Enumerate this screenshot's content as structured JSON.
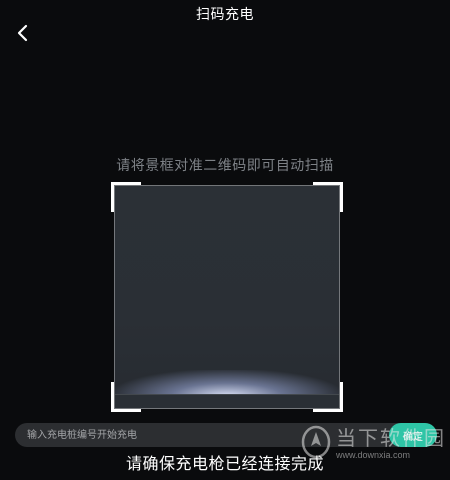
{
  "header": {
    "title": "扫码充电",
    "back_icon": "back-arrow-icon"
  },
  "scanner": {
    "hint": "请将景框对准二维码即可自动扫描",
    "corner_color": "#ffffff",
    "scan_line_icon": "scan-line"
  },
  "manual_entry": {
    "placeholder": "输入充电桩编号开始充电",
    "value": "",
    "confirm_label": "确定",
    "confirm_color": "#2ec5a6"
  },
  "footer": {
    "note": "请确保充电枪已经连接完成"
  },
  "watermark": {
    "text": "当下软件园",
    "url": "www.downxia.com"
  },
  "colors": {
    "background": "#0a0b0d",
    "hint_text": "#7d8186",
    "input_bg": "#2c2e31"
  }
}
